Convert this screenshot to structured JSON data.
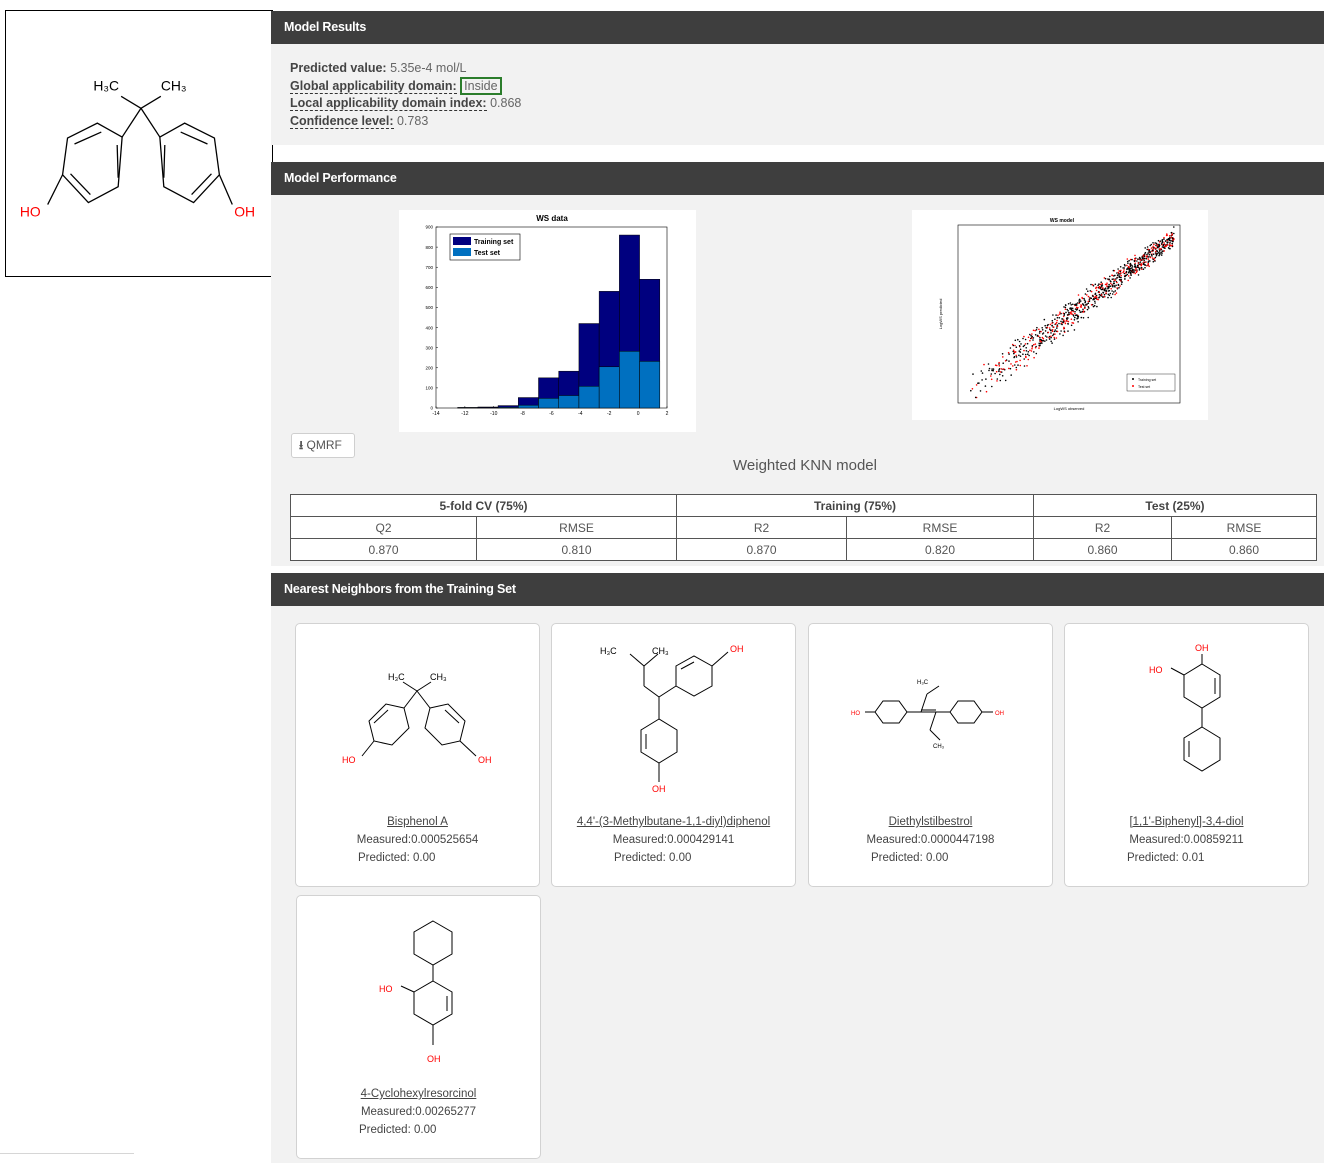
{
  "results": {
    "header": "Model Results",
    "predicted_label": "Predicted value:",
    "predicted_value": "5.35e-4 mol/L",
    "global_label": "Global applicability domain:",
    "global_value": "Inside",
    "local_label": "Local applicability domain index:",
    "local_value": "0.868",
    "confidence_label": "Confidence level:",
    "confidence_value": "0.783"
  },
  "query_structure": {
    "labels": {
      "me1": "H₃C",
      "me2": "CH₃",
      "oh_left": "HO",
      "oh_right": "OH"
    },
    "atom_color_oxygen": "#ff0000"
  },
  "performance": {
    "header": "Model Performance",
    "qmrf_label": "QMRF",
    "model_title": "Weighted KNN model",
    "table": {
      "groups": [
        "5-fold CV (75%)",
        "Training (75%)",
        "Test (25%)"
      ],
      "columns": [
        "Q2",
        "RMSE",
        "R2",
        "RMSE",
        "R2",
        "RMSE"
      ],
      "values": [
        "0.870",
        "0.810",
        "0.870",
        "0.820",
        "0.860",
        "0.860"
      ]
    }
  },
  "chart_data": [
    {
      "type": "bar",
      "title": "WS data",
      "x_ticks": [
        "-14",
        "-12",
        "-10",
        "-8",
        "-6",
        "-4",
        "-2",
        "0",
        "2"
      ],
      "y_ticks": [
        "0",
        "100",
        "200",
        "300",
        "400",
        "500",
        "600",
        "700",
        "800",
        "900"
      ],
      "ylim": [
        0,
        900
      ],
      "xlim": [
        -14,
        2
      ],
      "bin_width": 1.4,
      "bin_starts": [
        -12.5,
        -11.1,
        -9.7,
        -8.3,
        -6.9,
        -5.5,
        -4.1,
        -2.7,
        -1.3,
        0.1
      ],
      "series": [
        {
          "name": "Training set",
          "color": "#00007f",
          "values": [
            3,
            5,
            12,
            52,
            150,
            183,
            420,
            580,
            860,
            640
          ]
        },
        {
          "name": "Test set",
          "color": "#0070c0",
          "values": [
            1,
            2,
            4,
            14,
            48,
            62,
            108,
            205,
            282,
            232
          ]
        }
      ],
      "legend_position": "top-left"
    },
    {
      "type": "scatter",
      "title": "WS model",
      "xlabel": "LogWS observed",
      "ylabel": "LogWS predicted",
      "series": [
        {
          "name": "Training set",
          "color": "#000000"
        },
        {
          "name": "Test set",
          "color": "#ff0000"
        }
      ],
      "legend_position": "bottom-right"
    }
  ],
  "neighbors": {
    "header": "Nearest Neighbors from the Training Set",
    "items": [
      {
        "name": "Bisphenol A",
        "measured": "Measured:0.000525654",
        "predicted": "Predicted: 0.00"
      },
      {
        "name": "4,4'-(3-Methylbutane-1,1-diyl)diphenol",
        "measured": "Measured:0.000429141",
        "predicted": "Predicted: 0.00"
      },
      {
        "name": "Diethylstilbestrol",
        "measured": "Measured:0.0000447198",
        "predicted": "Predicted: 0.00"
      },
      {
        "name": "[1,1'-Biphenyl]-3,4-diol",
        "measured": "Measured:0.00859211",
        "predicted": "Predicted: 0.01"
      },
      {
        "name": "4-Cyclohexylresorcinol",
        "measured": "Measured:0.00265277",
        "predicted": "Predicted: 0.00"
      }
    ],
    "structure_labels": {
      "bpa_me1": "H₃C",
      "bpa_me2": "CH₃",
      "bpa_ho": "HO",
      "bpa_oh": "OH",
      "mb_me1": "H₃C",
      "mb_me2": "CH₃",
      "mb_oh1": "OH",
      "mb_oh2": "OH",
      "des_ho": "HO",
      "des_oh": "OH",
      "des_me1": "H₃C",
      "des_me2": "CH₃",
      "bp_oh": "OH",
      "bp_ho": "HO",
      "ch_ho": "HO",
      "ch_oh": "OH"
    }
  }
}
